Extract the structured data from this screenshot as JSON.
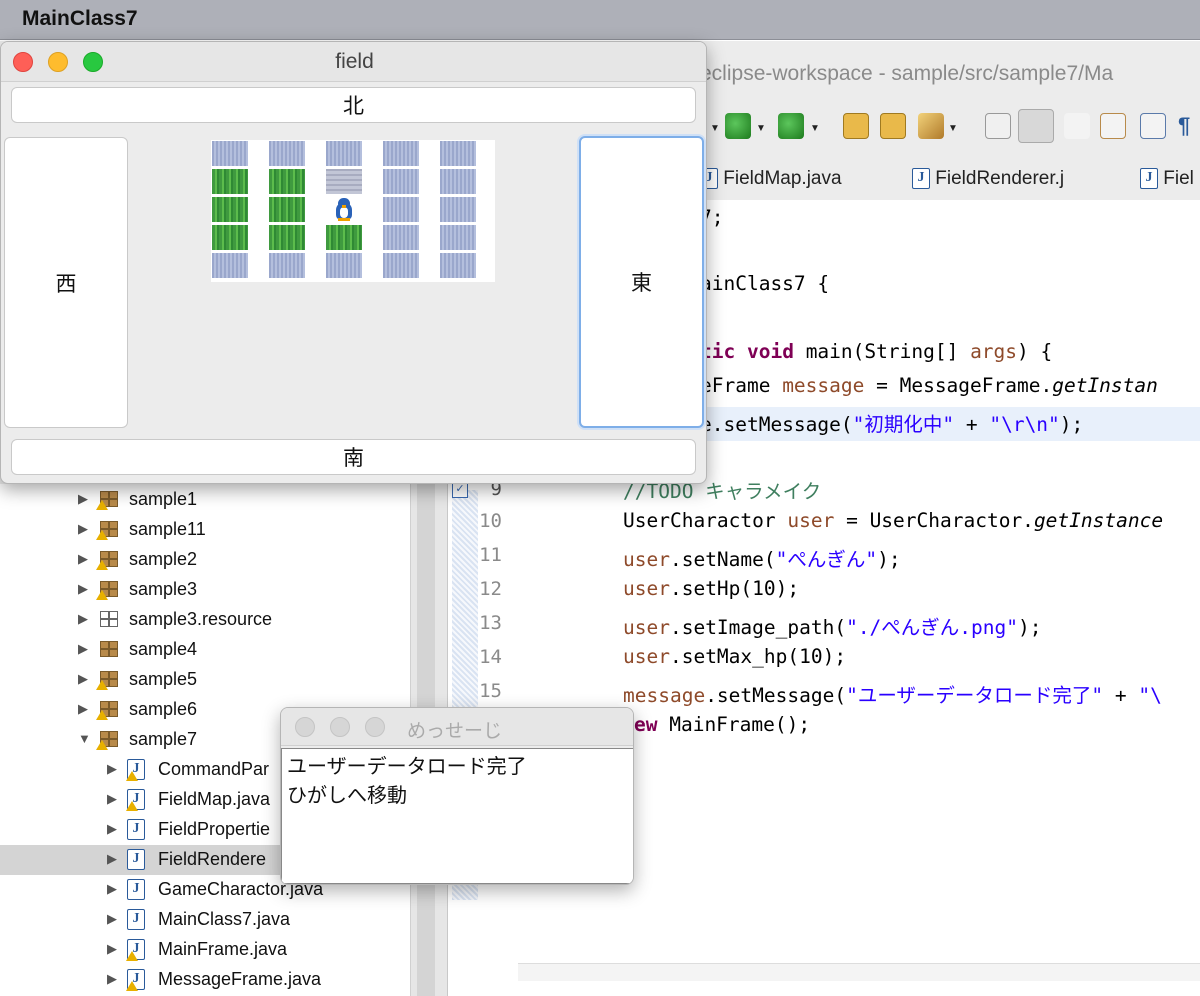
{
  "menubar": {
    "app_name": "MainClass7"
  },
  "eclipse": {
    "window_title": "eclipse-workspace - sample/src/sample7/Ma",
    "editor_tabs": [
      {
        "label": "FieldMap.java"
      },
      {
        "label": "FieldRenderer.j"
      },
      {
        "label": "Fiel"
      }
    ],
    "line_numbers": [
      "9",
      "10",
      "11",
      "12",
      "13",
      "14",
      "15"
    ],
    "code": {
      "l1": "7;",
      "l2": "ainClass7 {",
      "l3a": "tic",
      "l3b": " ",
      "l3c": "void",
      "l3d": " main(String[] ",
      "l3e": "args",
      "l3f": ") {",
      "l4a": "eFrame ",
      "l4b": "message",
      "l4c": " = MessageFrame.",
      "l4d": "getInstan",
      "l5a": "e.setMessage(",
      "l5b": "\"初期化中\"",
      "l5c": " + ",
      "l5d": "\"\\r\\n\"",
      "l5e": ");",
      "l9": "//TODO キャラメイク",
      "l10a": "UserCharactor ",
      "l10b": "user",
      "l10c": " = UserCharactor.",
      "l10d": "getInstance",
      "l11a": "user",
      "l11b": ".setName(",
      "l11c": "\"ぺんぎん\"",
      "l11d": ");",
      "l12a": "user",
      "l12b": ".setHp(10);",
      "l13a": "user",
      "l13b": ".setImage_path(",
      "l13c": "\"./ぺんぎん.png\"",
      "l13d": ");",
      "l14a": "user",
      "l14b": ".setMax_hp(10);",
      "l15a": "message",
      "l15b": ".setMessage(",
      "l15c": "\"ユーザーデータロード完了\"",
      "l15d": " + ",
      "l15e": "\"\\",
      "l16a": "ew",
      "l16b": " MainFrame();"
    }
  },
  "project_tree": [
    {
      "label": "sample1",
      "type": "package",
      "warning": true,
      "expanded": false
    },
    {
      "label": "sample11",
      "type": "package",
      "warning": true,
      "expanded": false
    },
    {
      "label": "sample2",
      "type": "package",
      "warning": true,
      "expanded": false
    },
    {
      "label": "sample3",
      "type": "package",
      "warning": true,
      "expanded": false
    },
    {
      "label": "sample3.resource",
      "type": "empty-package",
      "warning": false,
      "expanded": false
    },
    {
      "label": "sample4",
      "type": "package",
      "warning": false,
      "expanded": false
    },
    {
      "label": "sample5",
      "type": "package",
      "warning": true,
      "expanded": false
    },
    {
      "label": "sample6",
      "type": "package",
      "warning": true,
      "expanded": false
    },
    {
      "label": "sample7",
      "type": "package",
      "warning": true,
      "expanded": true
    },
    {
      "label": "CommandPar",
      "type": "java",
      "warning": true,
      "expanded": false
    },
    {
      "label": "FieldMap.java",
      "type": "java",
      "warning": true,
      "expanded": false
    },
    {
      "label": "FieldPropertie",
      "type": "java",
      "warning": false,
      "expanded": false
    },
    {
      "label": "FieldRendere",
      "type": "java",
      "warning": false,
      "expanded": false,
      "selected": true
    },
    {
      "label": "GameCharactor.java",
      "type": "java",
      "warning": false,
      "expanded": false
    },
    {
      "label": "MainClass7.java",
      "type": "java",
      "warning": false,
      "expanded": false
    },
    {
      "label": "MainFrame.java",
      "type": "java",
      "warning": true,
      "expanded": false
    },
    {
      "label": "MessageFrame.java",
      "type": "java",
      "warning": true,
      "expanded": false
    }
  ],
  "field_window": {
    "title": "field",
    "north_label": "北",
    "south_label": "南",
    "west_label": "西",
    "east_label": "東",
    "map_grid": [
      [
        "water",
        "water",
        "water",
        "water",
        "water"
      ],
      [
        "grass",
        "grass",
        "stone",
        "water",
        "water"
      ],
      [
        "grass",
        "grass",
        "player",
        "water",
        "water"
      ],
      [
        "grass",
        "grass",
        "grass",
        "water",
        "water"
      ],
      [
        "water",
        "water",
        "water",
        "water",
        "water"
      ]
    ]
  },
  "message_window": {
    "title": "めっせーじ",
    "lines": [
      "ユーザーデータロード完了",
      "ひがしへ移動"
    ]
  },
  "colors": {
    "keyword": "#7f0055",
    "string": "#2a00ff",
    "comment": "#3f7f5f",
    "field": "#8e4a2a",
    "focus_ring": "#7eaee8"
  }
}
